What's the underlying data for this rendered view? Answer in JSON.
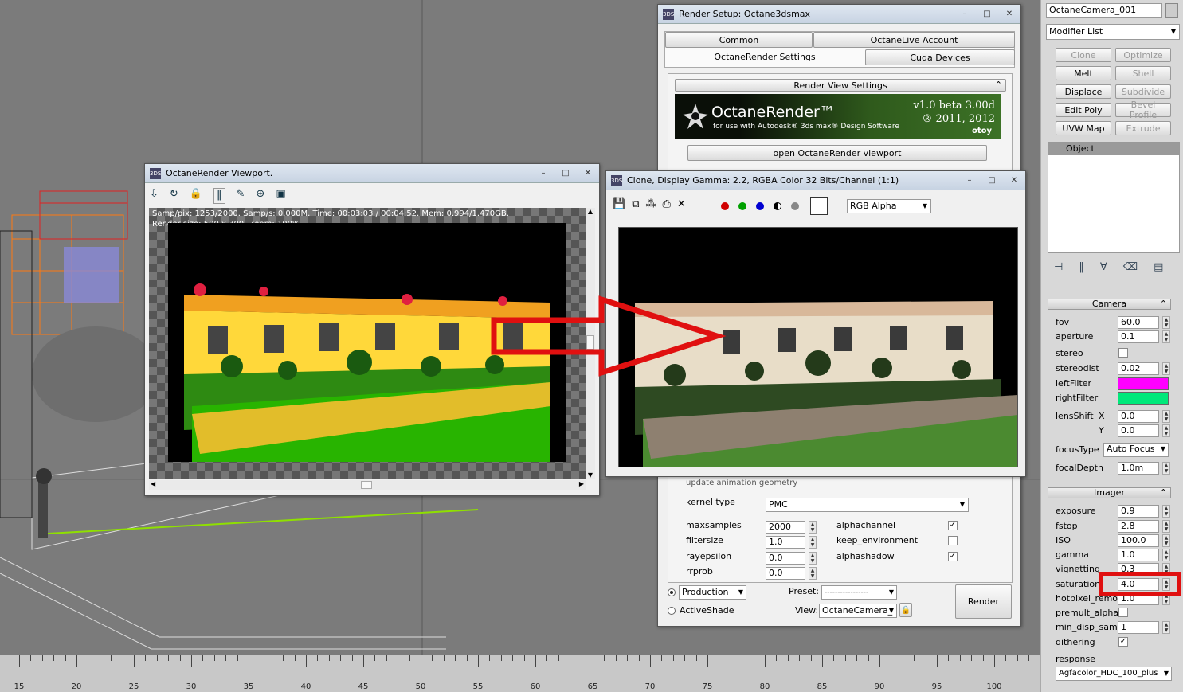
{
  "viewport": {
    "ruler_labels": [
      "15",
      "20",
      "25",
      "30",
      "35",
      "40",
      "45",
      "50",
      "55",
      "60",
      "65",
      "70",
      "75",
      "80",
      "85",
      "90",
      "95",
      "100"
    ]
  },
  "render_setup": {
    "title": "Render Setup: Octane3dsmax",
    "tabs": [
      "Common",
      "OctaneLive Account",
      "OctaneRender Settings",
      "Cuda Devices"
    ],
    "section": "Render View Settings",
    "banner_name": "OctaneRender™",
    "banner_sub": "for use with Autodesk® 3ds max® Design Software",
    "banner_version": "v1.0 beta 3.00d",
    "banner_copyright": "® 2011, 2012",
    "banner_brand": "otoy",
    "open_viewport": "open OctaneRender viewport",
    "hidden_row": "update animation geometry",
    "kernel_label": "kernel type",
    "kernel_value": "PMC",
    "maxsamples_label": "maxsamples",
    "maxsamples": "2000",
    "filtersize_label": "filtersize",
    "filtersize": "1.0",
    "rayepsilon_label": "rayepsilon",
    "rayepsilon": "0.0",
    "rrprob_label": "rrprob",
    "rrprob": "0.0",
    "alphachannel": "alphachannel",
    "keep_environment": "keep_environment",
    "alphashadow": "alphashadow",
    "production": "Production",
    "activeshade": "ActiveShade",
    "preset_label": "Preset:",
    "preset_value": "-----------------",
    "view_label": "View:",
    "view_value": "OctaneCamera_",
    "render_btn": "Render"
  },
  "octane_vp": {
    "title": "OctaneRender Viewport.",
    "stats1": "Samp/pix: 1253/2000.   Samp/s: 0.000M.   Time: 00:03:03 / 00:04:52.   Mem: 0.994/1.470GB.",
    "stats2": "Render size: 500 x 300.   Zoom: 100%."
  },
  "clone": {
    "title": "Clone, Display Gamma: 2.2, RGBA Color 32 Bits/Channel (1:1)",
    "channel": "RGB Alpha",
    "colors": [
      "#d00000",
      "#00a000",
      "#0000d0"
    ]
  },
  "panel": {
    "object_name": "OctaneCamera_001",
    "modifier_list": "Modifier List",
    "buttons": [
      "Clone",
      "Optimize",
      "Melt",
      "Shell",
      "Displace",
      "Subdivide",
      "Edit Poly",
      "Bevel Profile",
      "UVW Map",
      "Extrude"
    ],
    "stack_item": "Object",
    "camera": {
      "title": "Camera",
      "fov_l": "fov",
      "fov": "60.0",
      "aperture_l": "aperture",
      "aperture": "0.1",
      "stereo_l": "stereo",
      "stereodist_l": "stereodist",
      "stereodist": "0.02",
      "leftfilter_l": "leftFilter",
      "leftfilter_color": "#ff00ff",
      "rightfilter_l": "rightFilter",
      "rightfilter_color": "#00e87a",
      "lensshift_l": "lensShift",
      "x_l": "X",
      "x": "0.0",
      "y_l": "Y",
      "y": "0.0",
      "focustype_l": "focusType",
      "focustype": "Auto Focus",
      "focaldepth_l": "focalDepth",
      "focaldepth": "1.0m"
    },
    "imager": {
      "title": "Imager",
      "exposure_l": "exposure",
      "exposure": "0.9",
      "fstop_l": "fstop",
      "fstop": "2.8",
      "iso_l": "ISO",
      "iso": "100.0",
      "gamma_l": "gamma",
      "gamma": "1.0",
      "vignetting_l": "vignetting",
      "vignetting": "0.3",
      "saturation_l": "saturation",
      "saturation": "4.0",
      "hotpixel_l": "hotpixel_remov",
      "hotpixel": "1.0",
      "premult_l": "premult_alpha",
      "mindisp_l": "min_disp_samp.",
      "mindisp": "1",
      "dithering_l": "dithering",
      "response_l": "response",
      "response": "Agfacolor_HDC_100_plus"
    }
  },
  "highlight_color": "#e01010"
}
